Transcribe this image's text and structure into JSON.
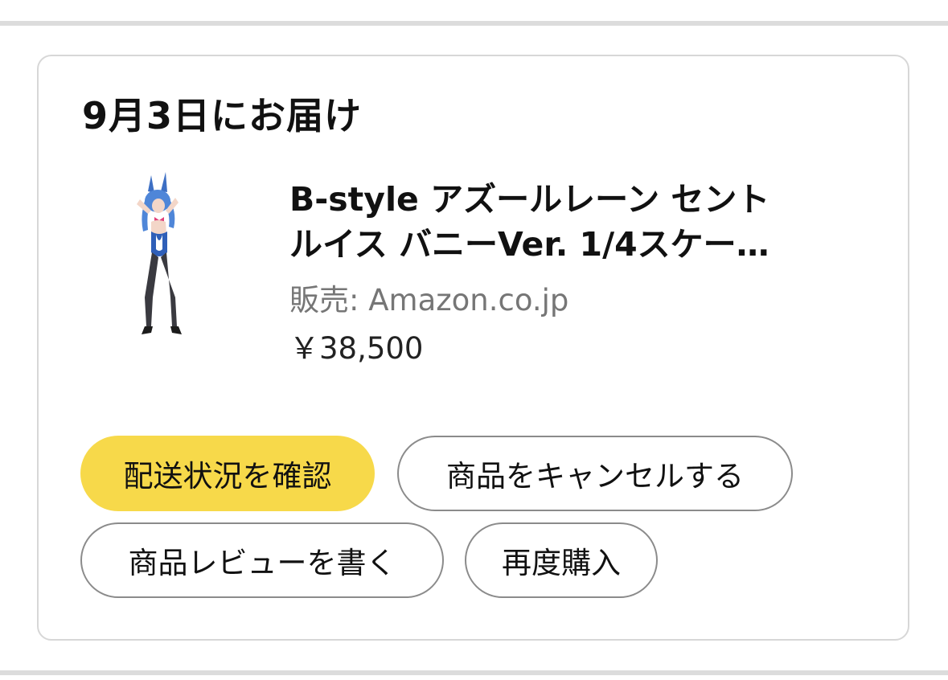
{
  "order": {
    "delivery_title": "9月3日にお届け",
    "product": {
      "image_icon": "figure-thumbnail",
      "title_line1": "B-style アズールレーン セント",
      "title_line2": "ルイス バニーVer. 1/4スケー…",
      "seller": "販売: Amazon.co.jp",
      "price": "￥38,500"
    },
    "actions": {
      "track_label": "配送状況を確認",
      "cancel_label": "商品をキャンセルする",
      "review_label": "商品レビューを書く",
      "rebuy_label": "再度購入"
    }
  },
  "colors": {
    "primary_button": "#f7d94a",
    "card_border": "#d7d7d7",
    "divider": "#dcdcdc",
    "seller_text": "#767676"
  }
}
